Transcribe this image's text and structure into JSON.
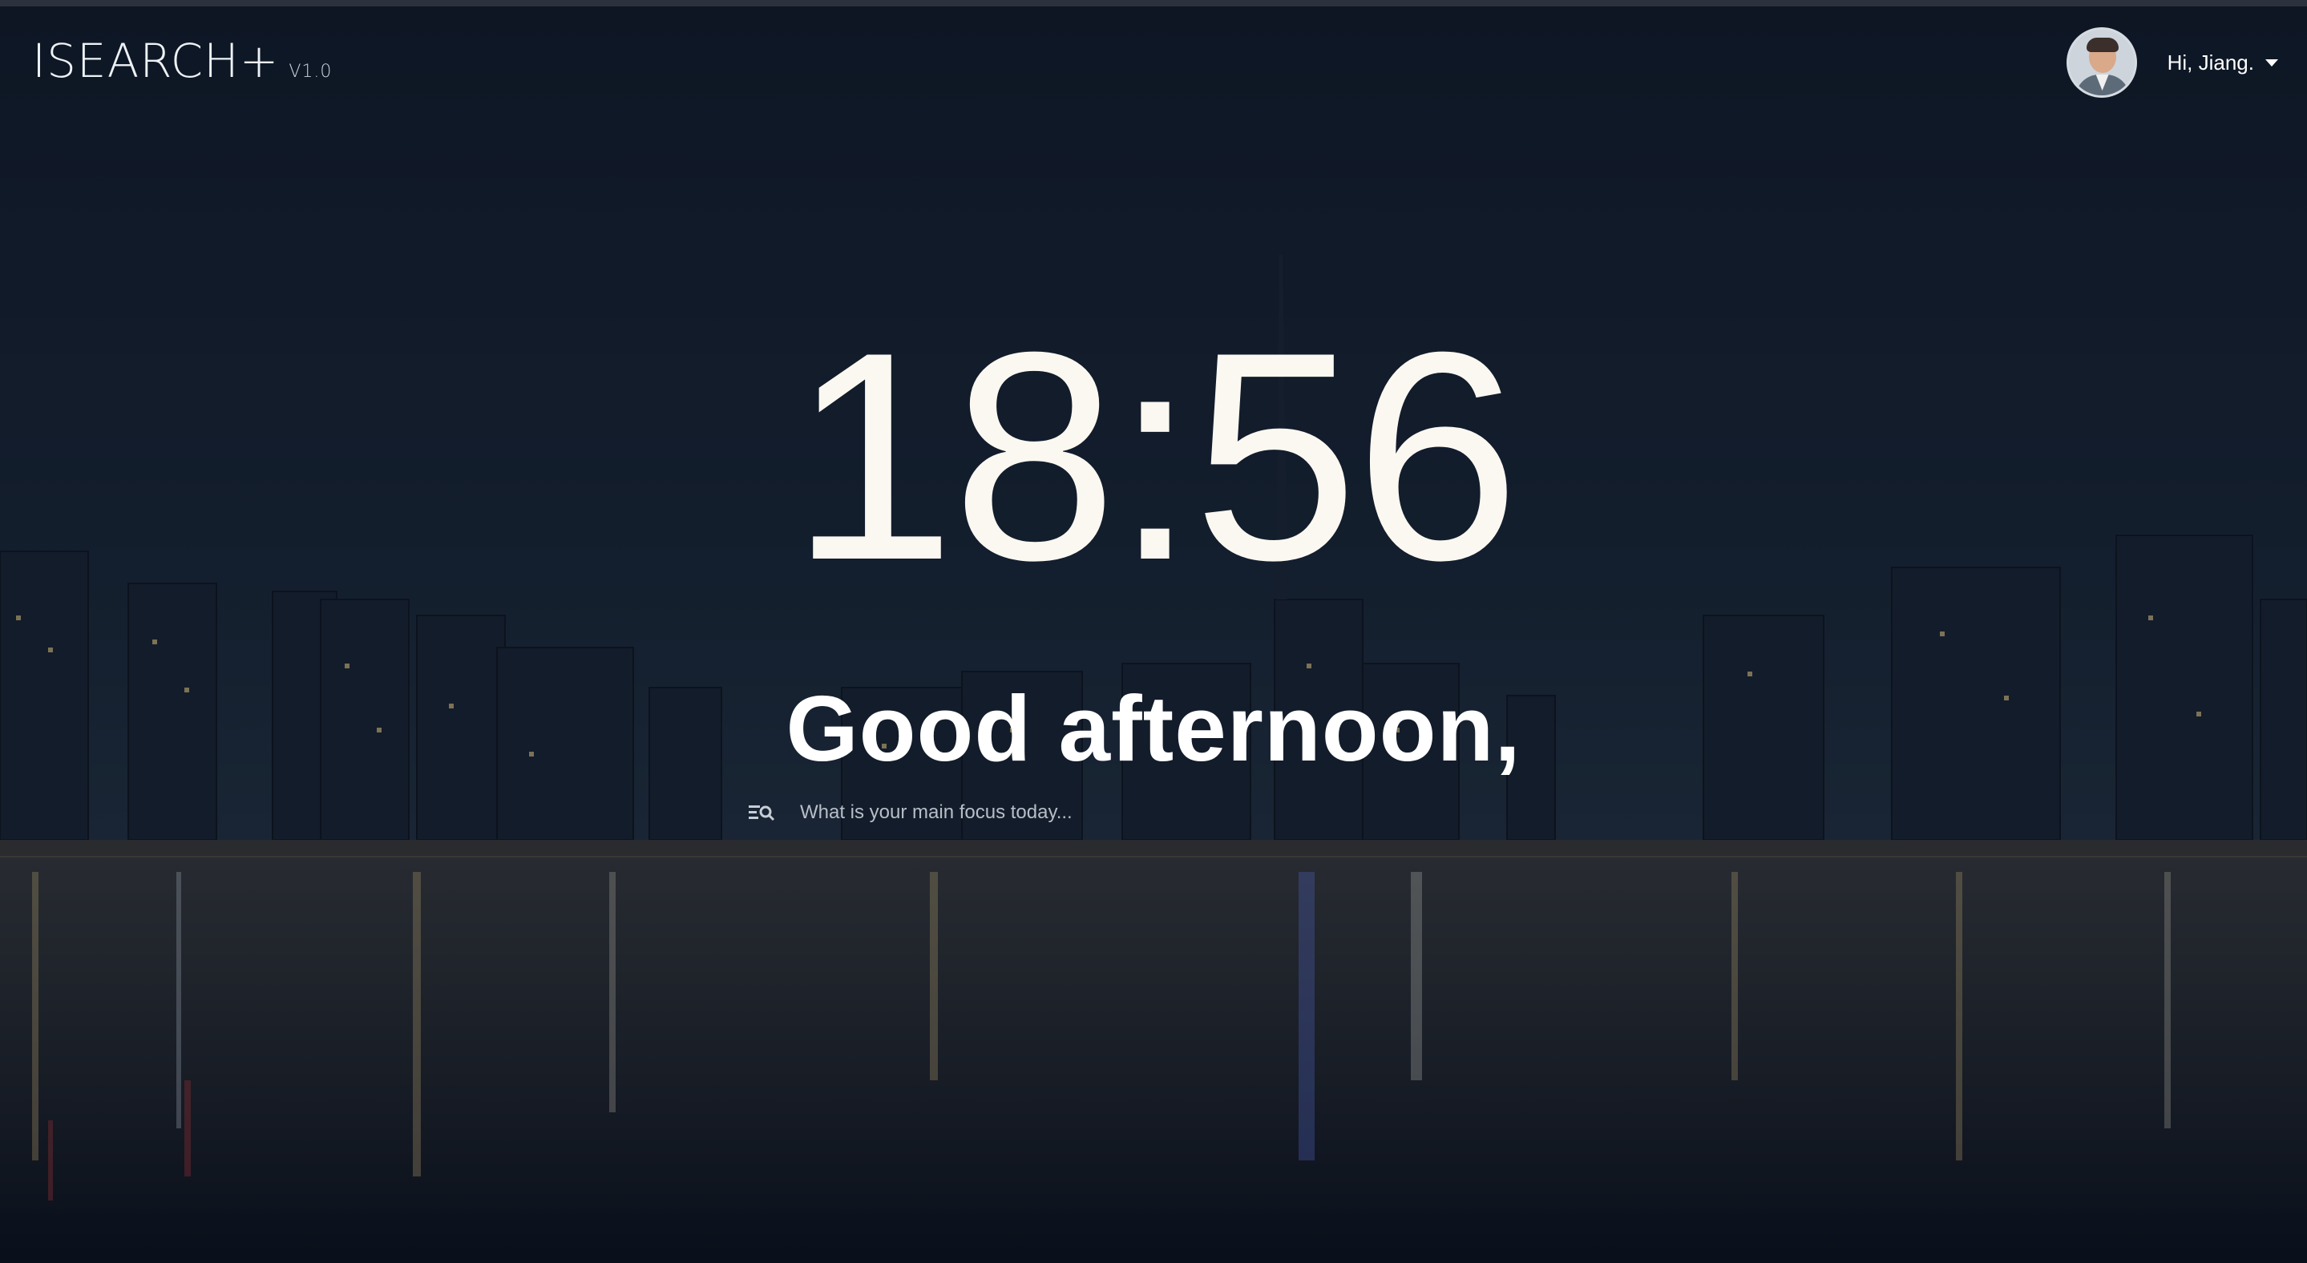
{
  "app": {
    "name": "ISEARCH+",
    "version": "V1.0"
  },
  "user": {
    "greeting": "Hi, Jiang.",
    "menu_icon": "caret-down-icon",
    "avatar_icon": "user-avatar"
  },
  "clock": {
    "time": "18:56"
  },
  "greeting": {
    "text": "Good afternoon,"
  },
  "focus": {
    "placeholder": "What is your main focus today...",
    "value": "",
    "icon": "search-list-icon"
  },
  "theme": {
    "text": "#ffffff",
    "clock": "#fbf8f1",
    "sky_top": "#0f1826",
    "water": "#0b1220"
  }
}
